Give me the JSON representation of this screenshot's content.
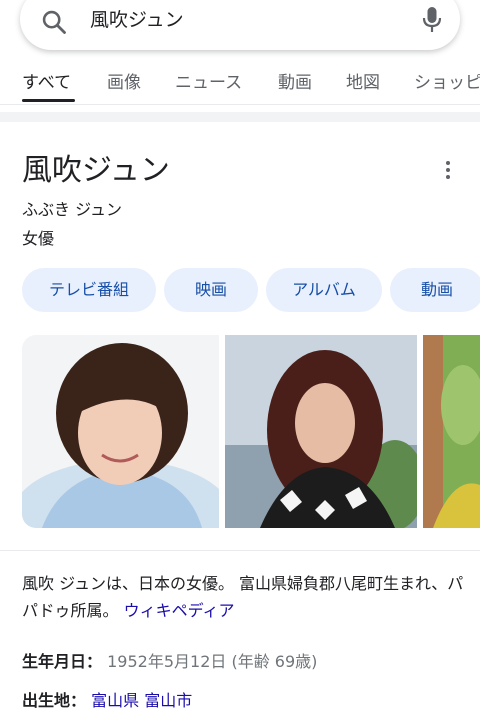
{
  "search": {
    "query": "風吹ジュン"
  },
  "tabs": [
    {
      "label": "すべて",
      "active": true
    },
    {
      "label": "画像"
    },
    {
      "label": "ニュース"
    },
    {
      "label": "動画"
    },
    {
      "label": "地図"
    },
    {
      "label": "ショッピング"
    }
  ],
  "entity": {
    "title": "風吹ジュン",
    "reading": "ふぶき ジュン",
    "type": "女優",
    "chips": [
      "テレビ番組",
      "映画",
      "アルバム",
      "動画"
    ],
    "description": "風吹 ジュンは、日本の女優。 富山県婦負郡八尾町生まれ、パパドゥ所属。",
    "source_link": "ウィキペディア",
    "facts": [
      {
        "label": "生年月日：",
        "value": "1952年5月12日 (年齢 69歳)"
      },
      {
        "label": "出生地：",
        "links": [
          "富山県",
          "富山市"
        ]
      }
    ]
  },
  "icons": {
    "search": "search-icon",
    "mic": "mic-icon",
    "more": "more-vert-icon"
  },
  "colors": {
    "chip_bg": "#e8f0fe",
    "chip_text": "#174ea6",
    "link": "#1a0dab",
    "muted": "#70757a"
  }
}
